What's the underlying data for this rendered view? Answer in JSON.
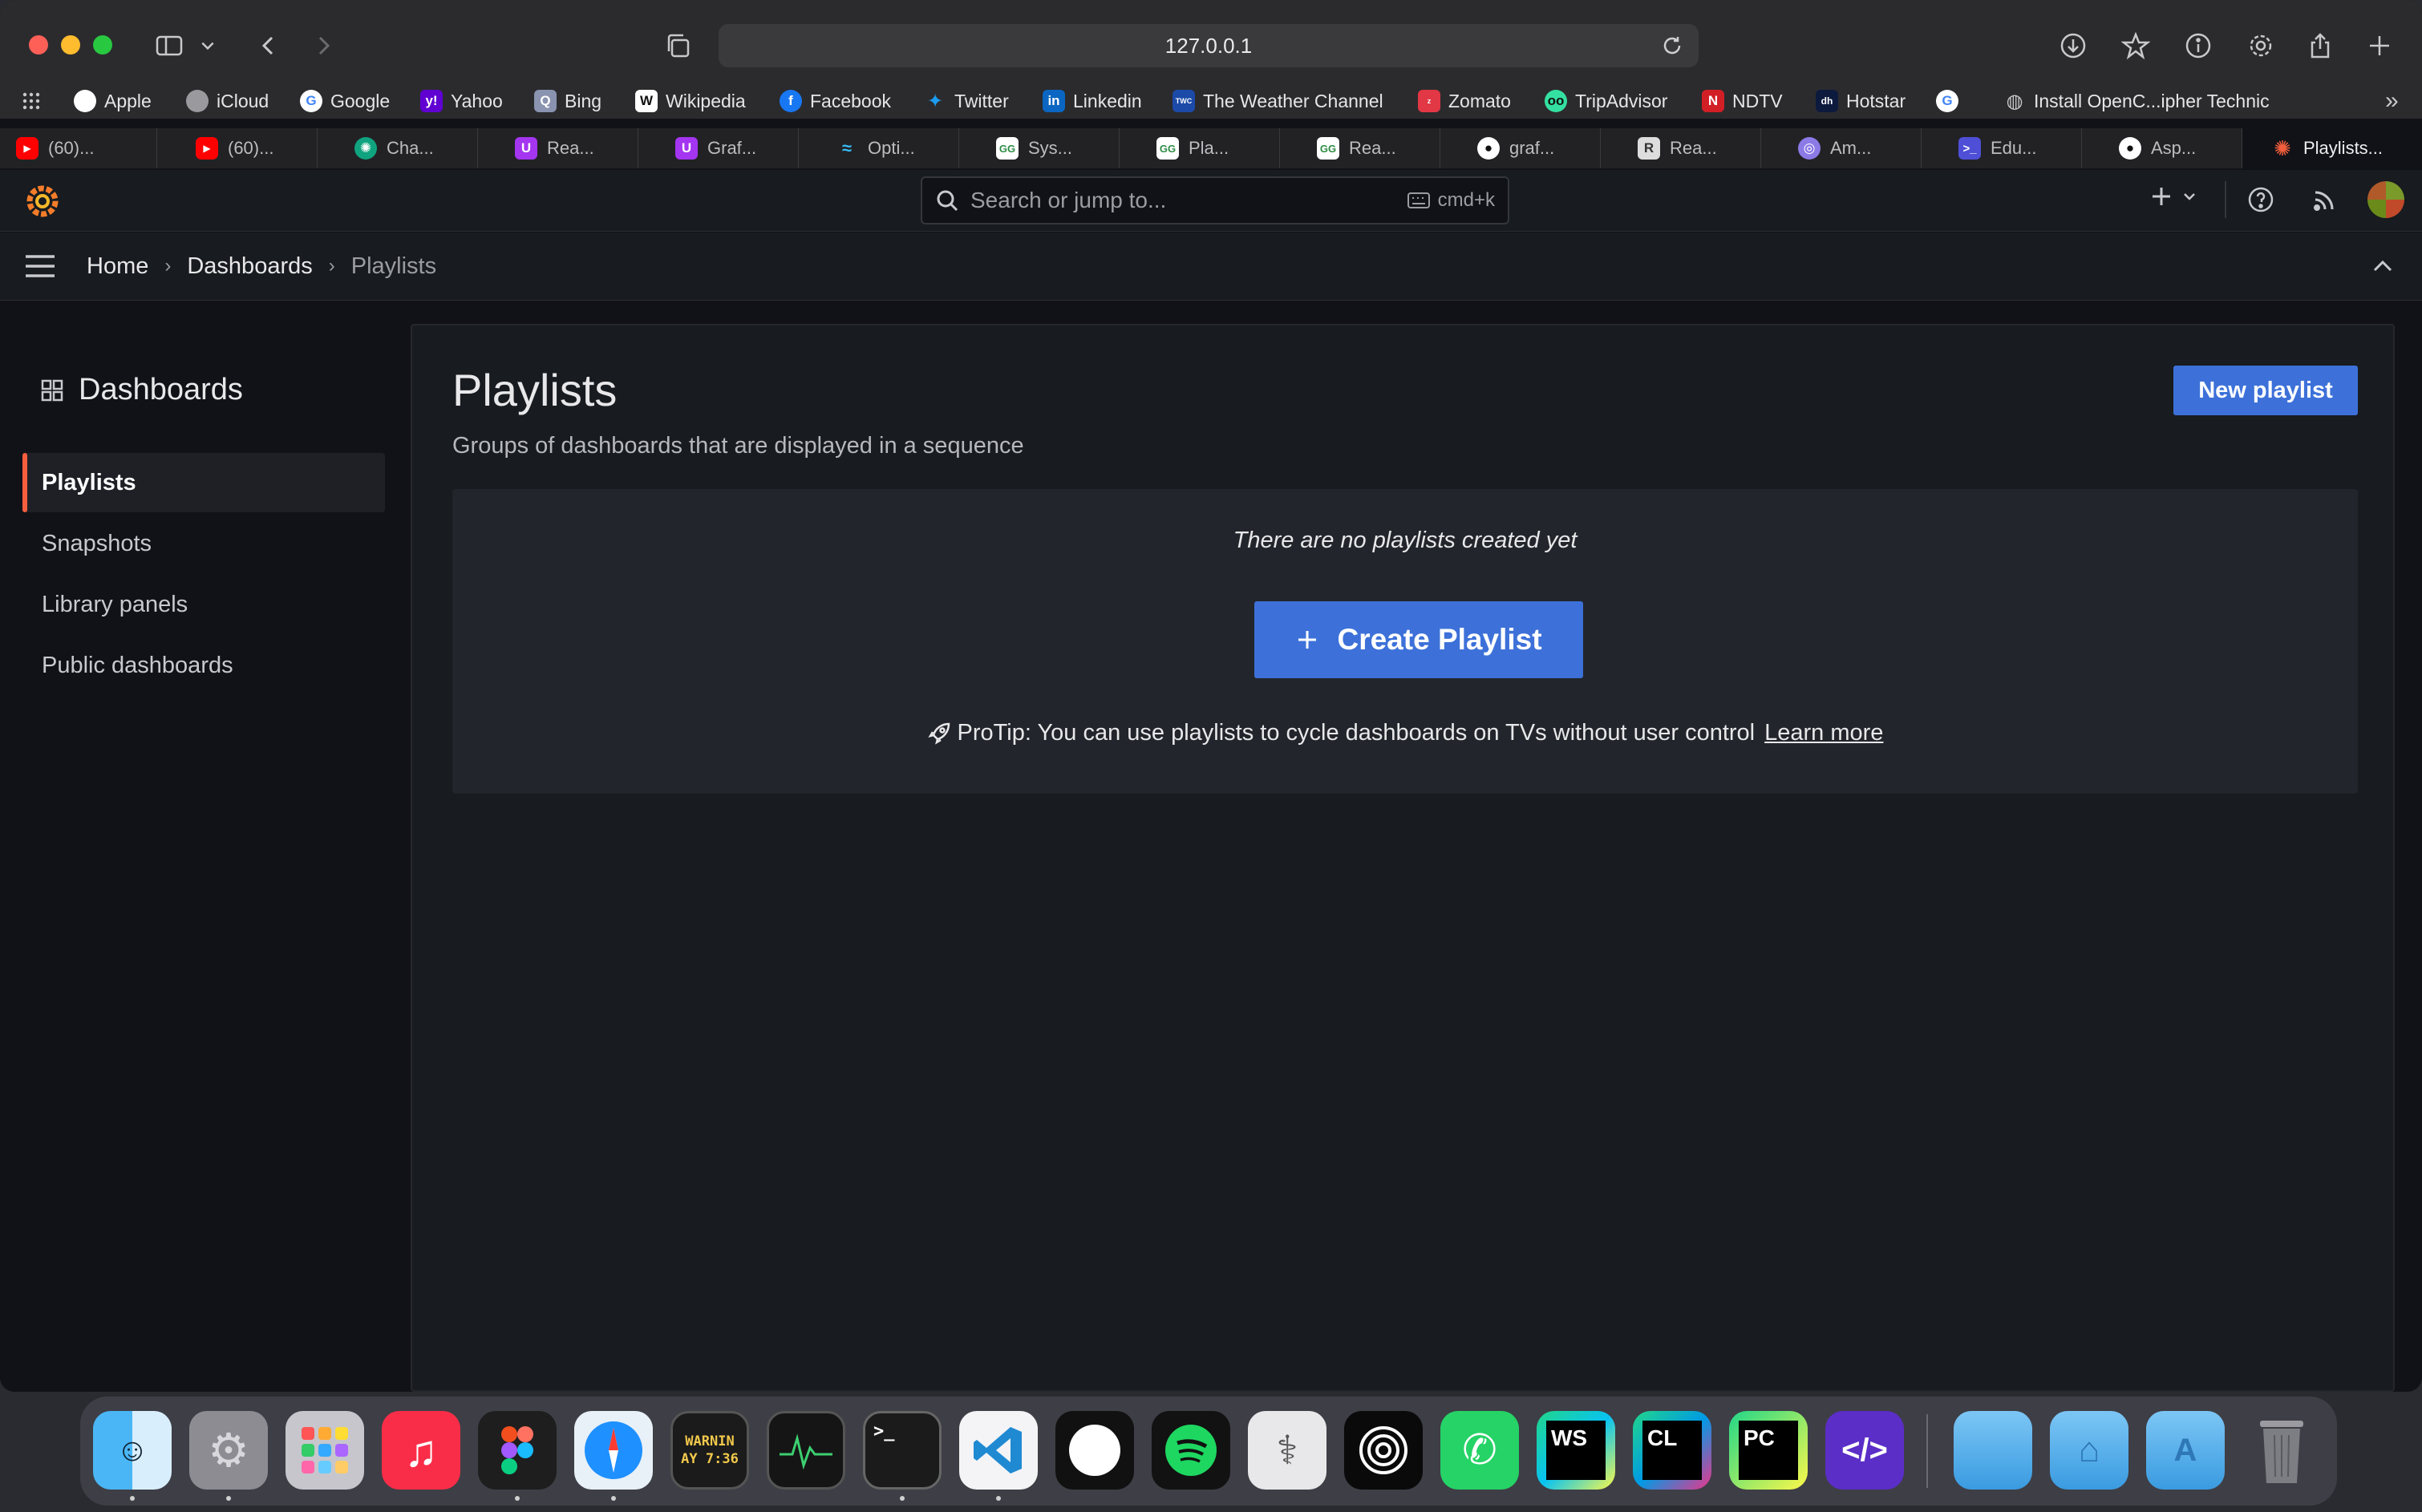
{
  "browser": {
    "url": "127.0.0.1",
    "bookmarks": [
      {
        "label": "Apple",
        "icon": "apple-icon"
      },
      {
        "label": "iCloud",
        "icon": "apple-icon"
      },
      {
        "label": "Google",
        "icon": "google-icon"
      },
      {
        "label": "Yahoo",
        "icon": "yahoo-icon"
      },
      {
        "label": "Bing",
        "icon": "bing-icon"
      },
      {
        "label": "Wikipedia",
        "icon": "wikipedia-icon"
      },
      {
        "label": "Facebook",
        "icon": "facebook-icon"
      },
      {
        "label": "Twitter",
        "icon": "twitter-icon"
      },
      {
        "label": "Linkedin",
        "icon": "linkedin-icon"
      },
      {
        "label": "The Weather Channel",
        "icon": "weather-channel-icon"
      },
      {
        "label": "Zomato",
        "icon": "zomato-icon"
      },
      {
        "label": "TripAdvisor",
        "icon": "tripadvisor-icon"
      },
      {
        "label": "NDTV",
        "icon": "ndtv-icon"
      },
      {
        "label": "Hotstar",
        "icon": "hotstar-icon"
      },
      {
        "label": "",
        "icon": "google-icon"
      },
      {
        "label": "Install OpenC...ipher Technic",
        "icon": "globe-icon"
      }
    ],
    "tabs": [
      {
        "label": "(60)...",
        "icon": "youtube-icon"
      },
      {
        "label": "(60)...",
        "icon": "youtube-icon"
      },
      {
        "label": "Cha...",
        "icon": "chatgpt-icon"
      },
      {
        "label": "Rea...",
        "icon": "udemy-icon"
      },
      {
        "label": "Graf...",
        "icon": "udemy-icon"
      },
      {
        "label": "Opti...",
        "icon": "tailwind-icon"
      },
      {
        "label": "Sys...",
        "icon": "geeksforgeeks-icon"
      },
      {
        "label": "Pla...",
        "icon": "geeksforgeeks-icon"
      },
      {
        "label": "Rea...",
        "icon": "geeksforgeeks-icon"
      },
      {
        "label": "graf...",
        "icon": "github-icon"
      },
      {
        "label": "Rea...",
        "icon": "reactor-icon"
      },
      {
        "label": "Am...",
        "icon": "am-icon"
      },
      {
        "label": "Edu...",
        "icon": "terminal-icon"
      },
      {
        "label": "Asp...",
        "icon": "github-icon"
      },
      {
        "label": "Playlists...",
        "icon": "grafana-icon"
      }
    ]
  },
  "grafana": {
    "search_placeholder": "Search or jump to...",
    "search_shortcut": "cmd+k",
    "breadcrumbs": [
      "Home",
      "Dashboards",
      "Playlists"
    ],
    "sidebar": {
      "title": "Dashboards",
      "items": [
        "Playlists",
        "Snapshots",
        "Library panels",
        "Public dashboards"
      ],
      "active": "Playlists"
    },
    "page": {
      "title": "Playlists",
      "subtitle": "Groups of dashboards that are displayed in a sequence",
      "new_button": "New playlist",
      "empty_message": "There are no playlists created yet",
      "create_button": "Create Playlist",
      "protip": "ProTip: You can use playlists to cycle dashboards on TVs without user control",
      "learn_more": "Learn more"
    }
  },
  "dock": {
    "console_text_1": "WARNIN",
    "console_text_2": "AY 7:36",
    "ws": "WS",
    "cl": "CL",
    "pc": "PC"
  },
  "colors": {
    "grafana_orange": "#f55f3e",
    "primary_button": "#3d71d9",
    "page_bg": "#111217",
    "panel_bg": "#181b1f"
  }
}
